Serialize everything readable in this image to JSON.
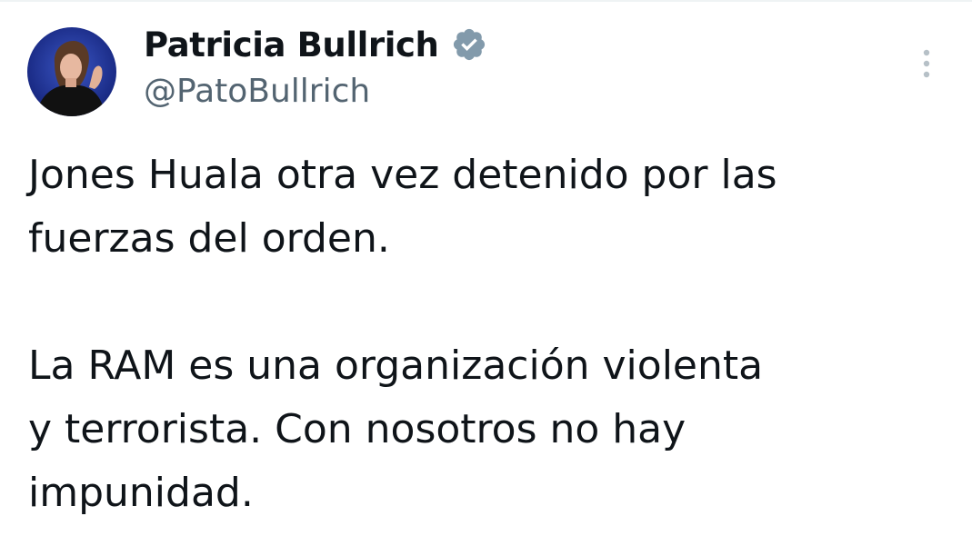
{
  "author": {
    "display_name": "Patricia Bullrich",
    "handle": "@PatoBullrich",
    "verified": true,
    "avatar_icon": "user-avatar"
  },
  "menu": {
    "icon": "more-vertical-icon"
  },
  "tweet": {
    "paragraph_1": "Jones Huala otra vez detenido por las\nfuerzas del orden.",
    "paragraph_2": "La RAM es una organización violenta\ny terrorista. Con nosotros no hay\nimpunidad."
  },
  "colors": {
    "text": "#0f1419",
    "secondary": "#536471",
    "badge": "#829aab",
    "avatar_bg": "#1a2f8f"
  }
}
